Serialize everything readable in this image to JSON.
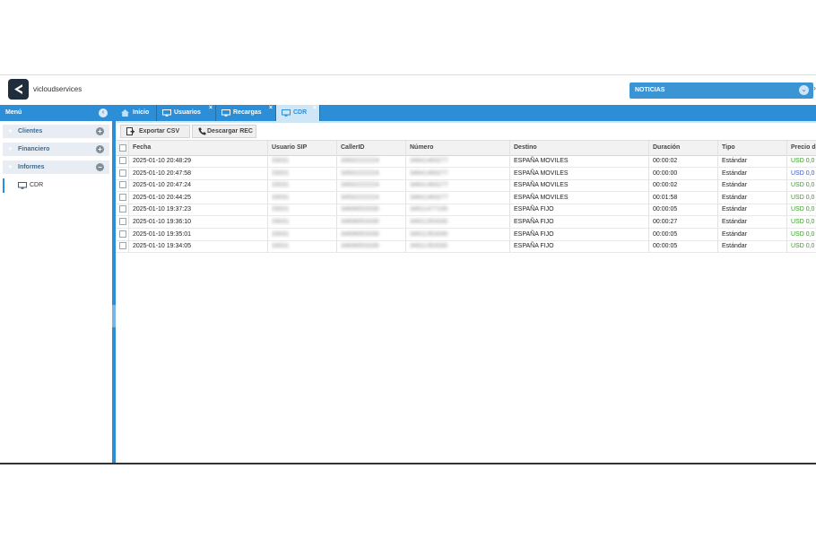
{
  "app": {
    "brand": "vicloudservices",
    "news_label": "NOTICIAS"
  },
  "menu": {
    "title": "Menú",
    "sections": [
      {
        "label": "Clientes",
        "state": "+"
      },
      {
        "label": "Financiero",
        "state": "+"
      },
      {
        "label": "Informes",
        "state": "−"
      }
    ],
    "item_cdr": "CDR"
  },
  "tabs": [
    {
      "label": "Inicio",
      "icon": "home-icon"
    },
    {
      "label": "Usuarios",
      "icon": "monitor-icon"
    },
    {
      "label": "Recargas",
      "icon": "monitor-icon"
    },
    {
      "label": "CDR",
      "icon": "monitor-icon",
      "active": true
    }
  ],
  "toolbar": {
    "export_csv": "Exportar CSV",
    "download_rec": "Descargar REC"
  },
  "table": {
    "columns": [
      "Fecha",
      "Usuario SIP",
      "CallerID",
      "Número",
      "Destino",
      "Duración",
      "Tipo",
      "Precio d"
    ],
    "rows": [
      [
        "2025-01-10 20:48:29",
        "33031",
        "34932222224",
        "34641483277",
        "ESPAÑA MOVILES",
        "00:00:02",
        "Estándar",
        "USD 0,0"
      ],
      [
        "2025-01-10 20:47:58",
        "33031",
        "34932222224",
        "34641483277",
        "ESPAÑA MOVILES",
        "00:00:00",
        "Estándar",
        "USD 0,0"
      ],
      [
        "2025-01-10 20:47:24",
        "33031",
        "34932222224",
        "34641483277",
        "ESPAÑA MOVILES",
        "00:00:02",
        "Estándar",
        "USD 0,0"
      ],
      [
        "2025-01-10 20:44:25",
        "33031",
        "34932222224",
        "34641483277",
        "ESPAÑA MOVILES",
        "00:01:58",
        "Estándar",
        "USD 0,0"
      ],
      [
        "2025-01-10 19:37:23",
        "33031",
        "34696553330",
        "34911477100",
        "ESPAÑA FIJO",
        "00:00:05",
        "Estándar",
        "USD 0,0"
      ],
      [
        "2025-01-10 19:36:10",
        "33031",
        "34696553330",
        "34911353330",
        "ESPAÑA FIJO",
        "00:00:27",
        "Estándar",
        "USD 0,0"
      ],
      [
        "2025-01-10 19:35:01",
        "33031",
        "34696553330",
        "34911353330",
        "ESPAÑA FIJO",
        "00:00:05",
        "Estándar",
        "USD 0,0"
      ],
      [
        "2025-01-10 19:34:05",
        "33031",
        "34696553330",
        "34911353330",
        "ESPAÑA FIJO",
        "00:00:05",
        "Estándar",
        "USD 0,0"
      ]
    ],
    "price_colors": [
      "green",
      "blue",
      "green",
      "green",
      "green",
      "green",
      "green",
      "green"
    ]
  },
  "colors": {
    "accent": "#2c8ed6",
    "news": "#3b95d4",
    "price_green": "#3a9a2a",
    "price_blue": "#3a55c4"
  }
}
